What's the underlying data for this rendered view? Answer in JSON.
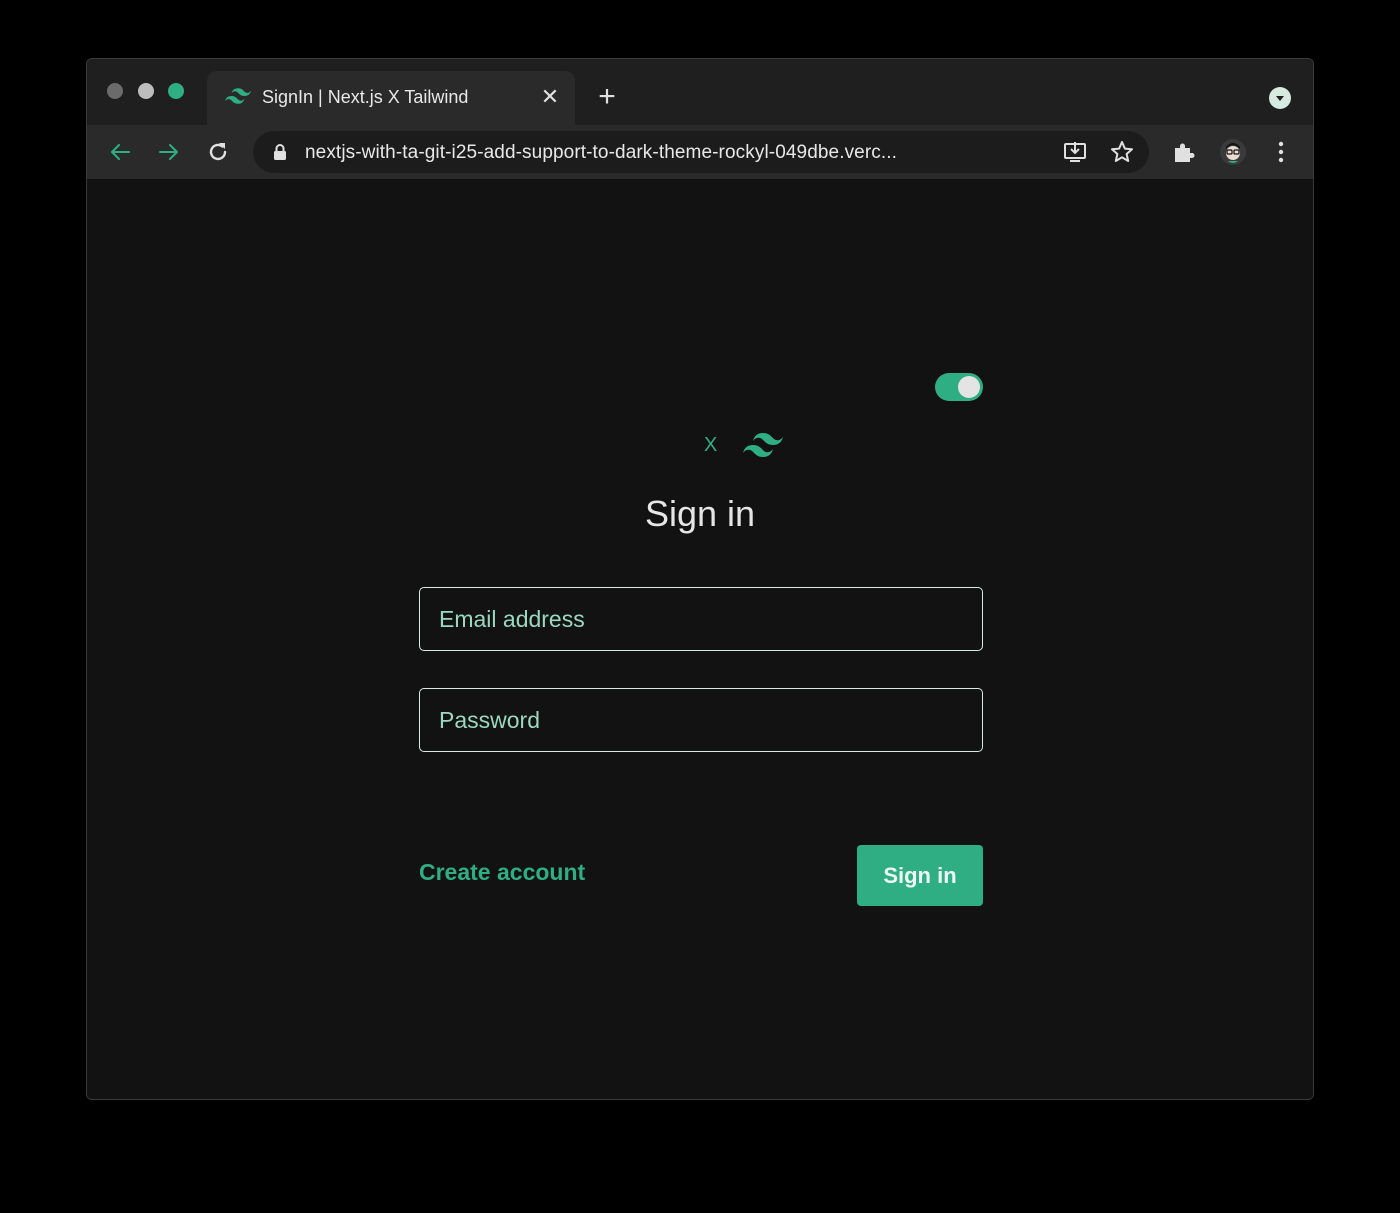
{
  "browser": {
    "tab": {
      "title": "SignIn | Next.js X Tailwind",
      "close_label": "✕"
    },
    "new_tab_label": "+",
    "address_bar": {
      "url": "nextjs-with-ta-git-i25-add-support-to-dark-theme-rockyl-049dbe.verc..."
    }
  },
  "page": {
    "logo_x": "X",
    "title": "Sign in",
    "email_placeholder": "Email address",
    "password_placeholder": "Password",
    "create_account_label": "Create account",
    "signin_button_label": "Sign in",
    "theme_toggle_on": true
  },
  "colors": {
    "accent": "#2fae84",
    "background": "#121212",
    "text": "#e6e6e6",
    "placeholder": "#9ad9c0"
  }
}
